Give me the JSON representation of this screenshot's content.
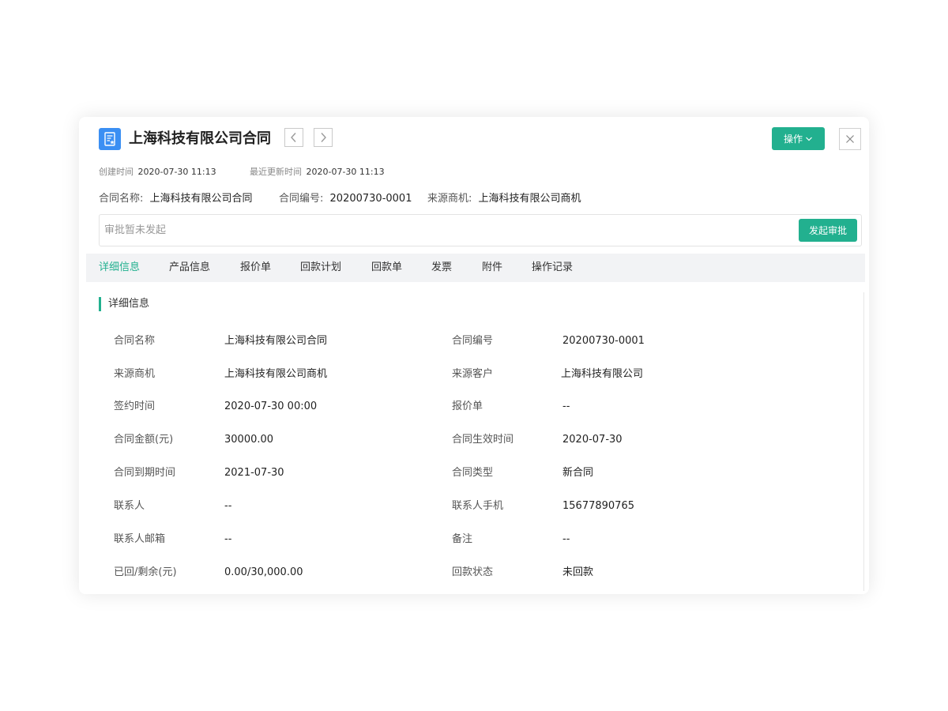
{
  "header": {
    "title": "上海科技有限公司合同",
    "actions_label": "操作",
    "close_symbol": "×"
  },
  "meta": {
    "created_label": "创建时间",
    "created_value": "2020-07-30 11:13",
    "updated_label": "最近更新时间",
    "updated_value": "2020-07-30 11:13"
  },
  "summary": [
    {
      "label": "合同名称:",
      "value": "上海科技有限公司合同"
    },
    {
      "label": "合同编号:",
      "value": "20200730-0001"
    },
    {
      "label": "来源商机:",
      "value": "上海科技有限公司商机"
    }
  ],
  "approval": {
    "status_text": "审批暂未发起",
    "button_label": "发起审批"
  },
  "tabs": [
    {
      "label": "详细信息",
      "active": true
    },
    {
      "label": "产品信息",
      "active": false
    },
    {
      "label": "报价单",
      "active": false
    },
    {
      "label": "回款计划",
      "active": false
    },
    {
      "label": "回款单",
      "active": false
    },
    {
      "label": "发票",
      "active": false
    },
    {
      "label": "附件",
      "active": false
    },
    {
      "label": "操作记录",
      "active": false
    }
  ],
  "section": {
    "title": "详细信息"
  },
  "fields": [
    {
      "label": "合同名称",
      "value": "上海科技有限公司合同"
    },
    {
      "label": "合同编号",
      "value": "20200730-0001"
    },
    {
      "label": "来源商机",
      "value": "上海科技有限公司商机"
    },
    {
      "label": "来源客户",
      "value": "上海科技有限公司"
    },
    {
      "label": "签约时间",
      "value": "2020-07-30 00:00"
    },
    {
      "label": "报价单",
      "value": "--"
    },
    {
      "label": "合同金额(元)",
      "value": "30000.00"
    },
    {
      "label": "合同生效时间",
      "value": "2020-07-30"
    },
    {
      "label": "合同到期时间",
      "value": "2021-07-30"
    },
    {
      "label": "合同类型",
      "value": "新合同"
    },
    {
      "label": "联系人",
      "value": "--"
    },
    {
      "label": "联系人手机",
      "value": "15677890765"
    },
    {
      "label": "联系人邮箱",
      "value": "--"
    },
    {
      "label": "备注",
      "value": "--"
    },
    {
      "label": "已回/剩余(元)",
      "value": "0.00/30,000.00"
    },
    {
      "label": "回款状态",
      "value": "未回款"
    }
  ],
  "colors": {
    "accent": "#22b08f",
    "icon_blue": "#3b8ff3",
    "tab_bar_bg": "#f2f3f5"
  },
  "icons": {
    "doc": "document-icon",
    "prev": "chevron-left-icon",
    "next": "chevron-right-icon",
    "dropdown": "chevron-down-icon",
    "close": "close-icon"
  }
}
